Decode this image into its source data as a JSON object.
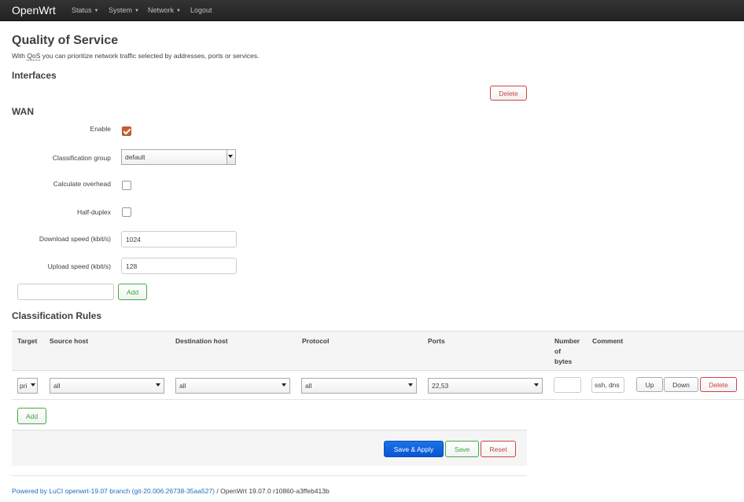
{
  "nav": {
    "brand": "OpenWrt",
    "items": [
      {
        "label": "Status",
        "has_dropdown": true
      },
      {
        "label": "System",
        "has_dropdown": true
      },
      {
        "label": "Network",
        "has_dropdown": true
      },
      {
        "label": "Logout",
        "has_dropdown": false
      }
    ]
  },
  "page": {
    "title": "Quality of Service",
    "desc_prefix": "With ",
    "desc_abbr": "QoS",
    "desc_suffix": " you can prioritize network traffic selected by addresses, ports or services."
  },
  "interfaces": {
    "title": "Interfaces",
    "delete_label": "Delete",
    "section_name": "WAN",
    "fields": {
      "enable_label": "Enable",
      "enable_checked": true,
      "classgroup_label": "Classification group",
      "classgroup_value": "default",
      "overhead_label": "Calculate overhead",
      "overhead_checked": false,
      "halfduplex_label": "Half-duplex",
      "halfduplex_checked": false,
      "download_label": "Download speed (kbit/s)",
      "download_value": "1024",
      "upload_label": "Upload speed (kbit/s)",
      "upload_value": "128"
    },
    "new_name_value": "",
    "add_label": "Add"
  },
  "rules": {
    "title": "Classification Rules",
    "headers": {
      "target": "Target",
      "source": "Source host",
      "destination": "Destination host",
      "protocol": "Protocol",
      "ports": "Ports",
      "bytes_line1": "Number",
      "bytes_line2": "of",
      "bytes_line3": "bytes",
      "comment": "Comment"
    },
    "row": {
      "target": "pri",
      "source": "all",
      "destination": "all",
      "protocol": "all",
      "ports": "22,53",
      "bytes": "",
      "comment": "ssh, dns",
      "up_label": "Up",
      "down_label": "Down",
      "delete_label": "Delete"
    },
    "add_label": "Add"
  },
  "actions": {
    "save_apply": "Save & Apply",
    "save": "Save",
    "reset": "Reset"
  },
  "footer": {
    "link_text": "Powered by LuCI openwrt-19.07 branch (git-20.006.26738-35aa527)",
    "rest_text": " / OpenWrt 19.07.0 r10860-a3ffeb413b"
  },
  "colors": {
    "navbar": "#222222",
    "primary": "#1a73e8",
    "danger": "#cc4444",
    "success": "#44aa44",
    "checkbox_checked": "#c8602f",
    "link": "#1d6fbf"
  }
}
